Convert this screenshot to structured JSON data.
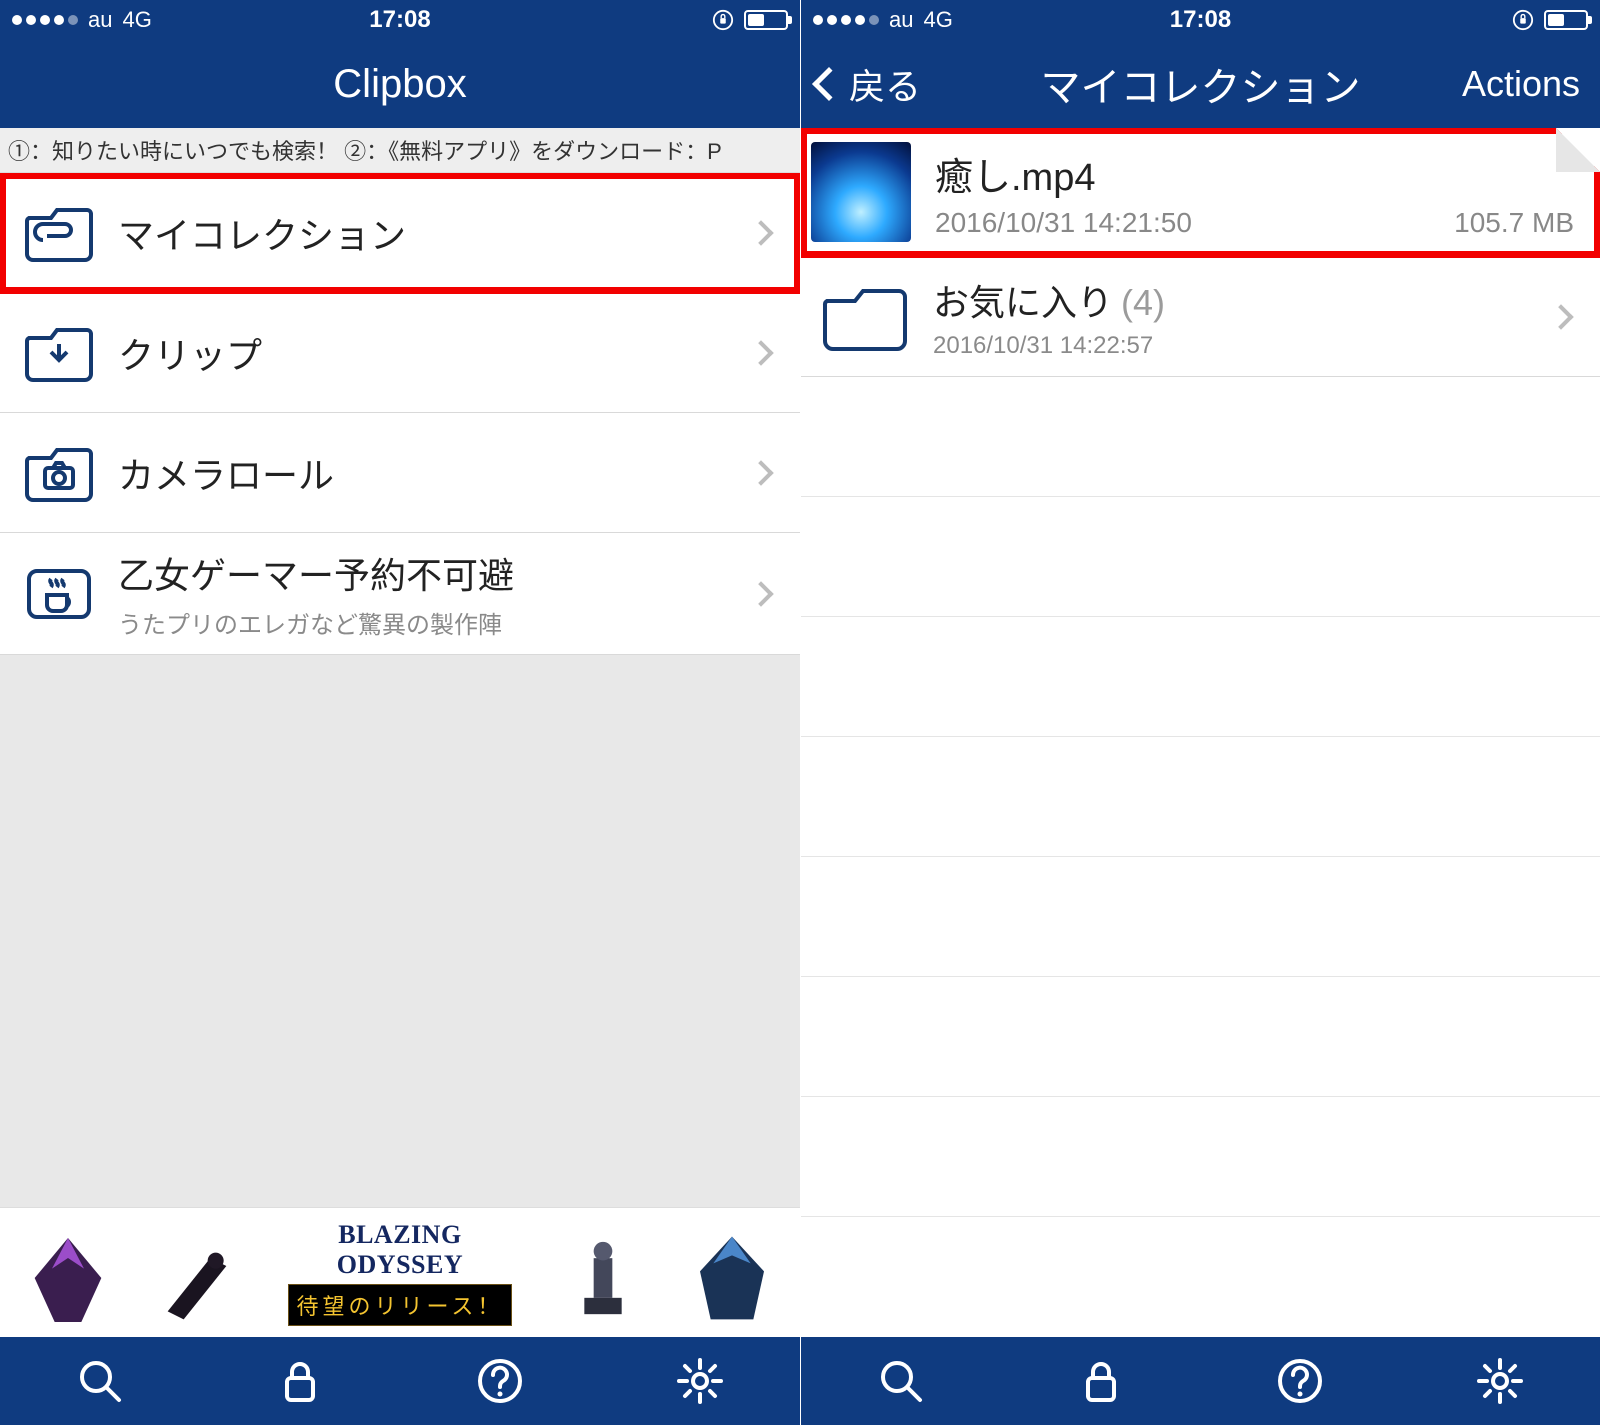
{
  "statusbar": {
    "carrier": "au",
    "network": "4G",
    "time": "17:08"
  },
  "left": {
    "title": "Clipbox",
    "notice": "①：知りたい時にいつでも検索！ ②：《無料アプリ》をダウンロード：P",
    "rows": [
      {
        "icon": "folder-clip-icon",
        "title": "マイコレクション"
      },
      {
        "icon": "folder-download-icon",
        "title": "クリップ"
      },
      {
        "icon": "folder-camera-icon",
        "title": "カメラロール"
      },
      {
        "icon": "folder-coffee-icon",
        "title": "乙女ゲーマー予約不可避",
        "sub": "うたプリのエレガなど驚異の製作陣"
      }
    ],
    "ad": {
      "title": "BLAZING ODYSSEY",
      "sub": "待望のリリース！"
    }
  },
  "right": {
    "back": "戻る",
    "title": "マイコレクション",
    "action": "Actions",
    "items": [
      {
        "type": "file",
        "name": "癒し.mp4",
        "date": "2016/10/31 14:21:50",
        "size": "105.7 MB"
      },
      {
        "type": "folder",
        "name": "お気に入り",
        "count": "(4)",
        "date": "2016/10/31 14:22:57"
      }
    ]
  },
  "toolbar_names": [
    "search-icon",
    "lock-icon",
    "help-icon",
    "settings-icon"
  ]
}
